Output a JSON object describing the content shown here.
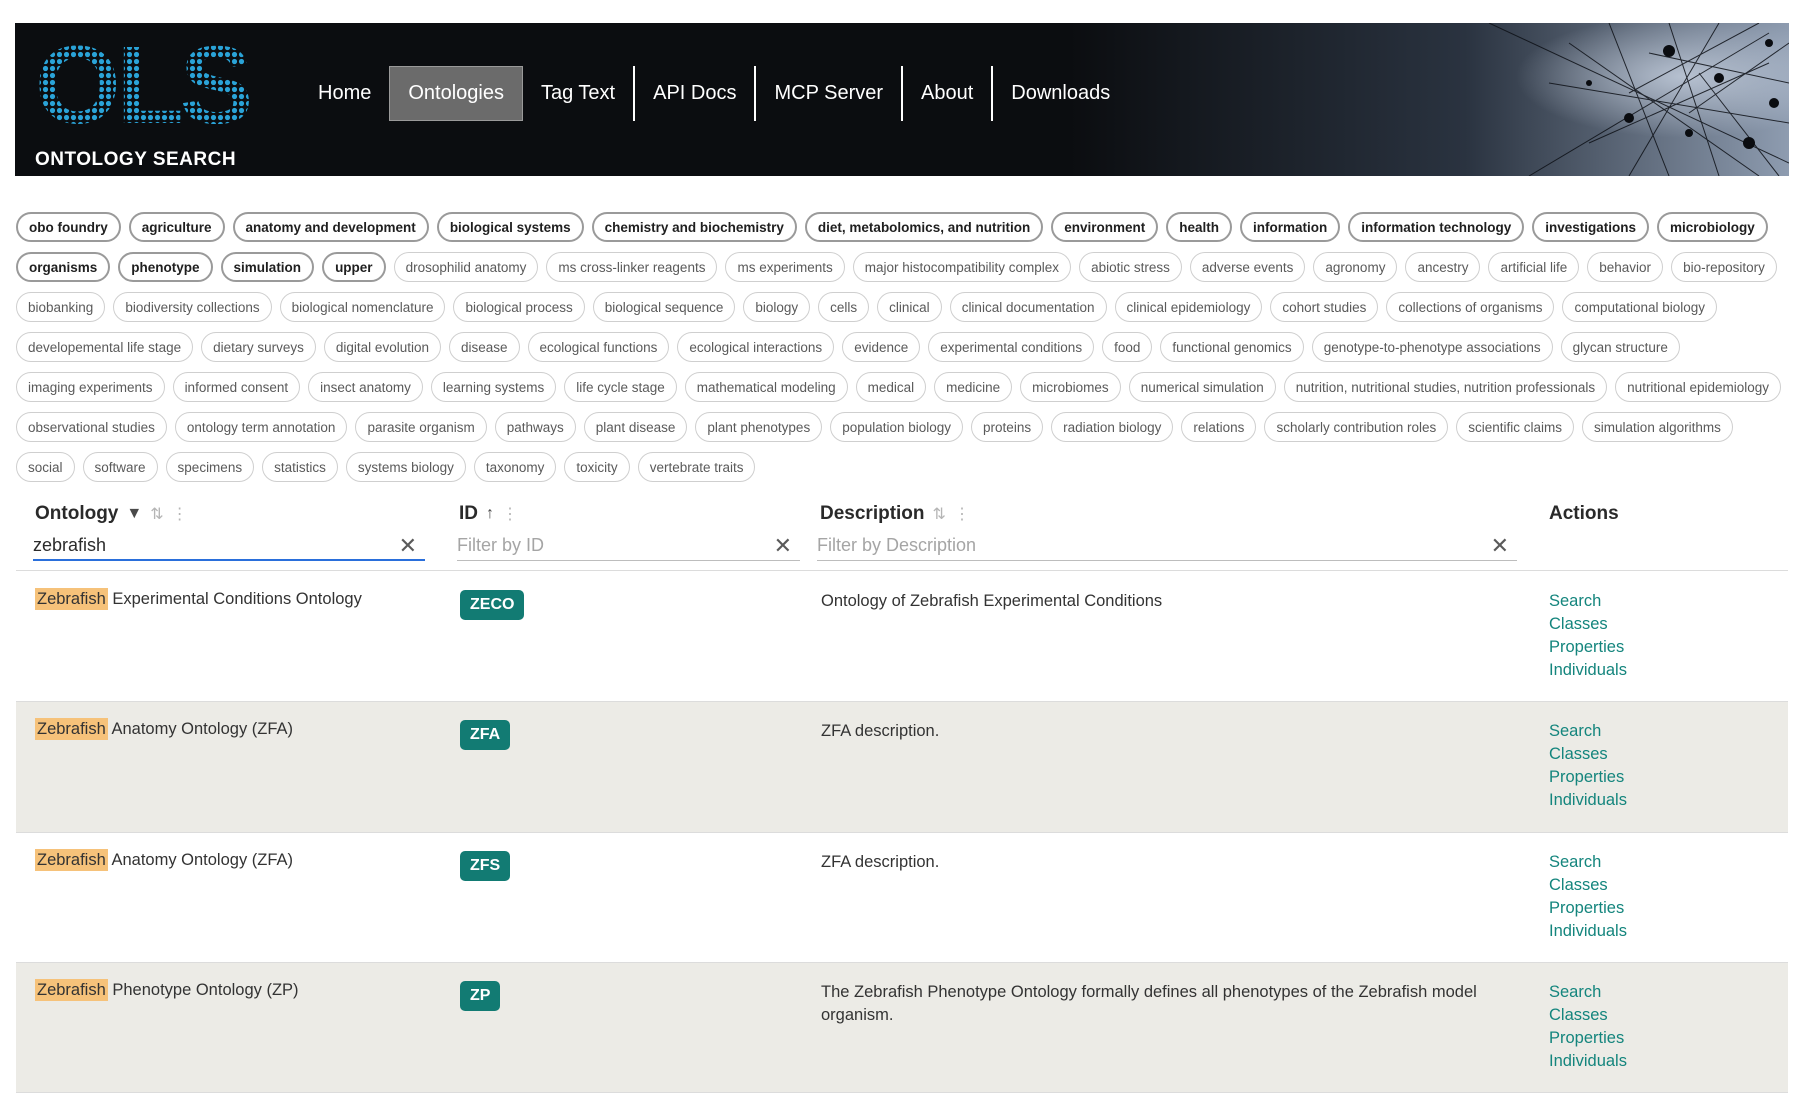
{
  "header": {
    "logo_text": "OLS",
    "logo_caption": "ONTOLOGY SEARCH",
    "nav": [
      "Home",
      "Ontologies",
      "Tag Text",
      "API Docs",
      "MCP Server",
      "About",
      "Downloads"
    ],
    "active_nav": "Ontologies"
  },
  "tags": {
    "bold": [
      "obo foundry",
      "agriculture",
      "anatomy and development",
      "biological systems",
      "chemistry and biochemistry",
      "diet, metabolomics, and nutrition",
      "environment",
      "health",
      "information",
      "information technology",
      "investigations",
      "microbiology",
      "organisms",
      "phenotype",
      "simulation",
      "upper"
    ],
    "normal": [
      "drosophilid anatomy",
      "ms cross-linker reagents",
      "ms experiments",
      "major histocompatibility complex",
      "abiotic stress",
      "adverse events",
      "agronomy",
      "ancestry",
      "artificial life",
      "behavior",
      "bio-repository",
      "biobanking",
      "biodiversity collections",
      "biological nomenclature",
      "biological process",
      "biological sequence",
      "biology",
      "cells",
      "clinical",
      "clinical documentation",
      "clinical epidemiology",
      "cohort studies",
      "collections of organisms",
      "computational biology",
      "developemental life stage",
      "dietary surveys",
      "digital evolution",
      "disease",
      "ecological functions",
      "ecological interactions",
      "evidence",
      "experimental conditions",
      "food",
      "functional genomics",
      "genotype-to-phenotype associations",
      "glycan structure",
      "imaging experiments",
      "informed consent",
      "insect anatomy",
      "learning systems",
      "life cycle stage",
      "mathematical modeling",
      "medical",
      "medicine",
      "microbiomes",
      "numerical simulation",
      "nutrition, nutritional studies, nutrition professionals",
      "nutritional epidemiology",
      "observational studies",
      "ontology term annotation",
      "parasite organism",
      "pathways",
      "plant disease",
      "plant phenotypes",
      "population biology",
      "proteins",
      "radiation biology",
      "relations",
      "scholarly contribution roles",
      "scientific claims",
      "simulation algorithms",
      "social",
      "software",
      "specimens",
      "statistics",
      "systems biology",
      "taxonomy",
      "toxicity",
      "vertebrate traits"
    ]
  },
  "table": {
    "columns": {
      "ontology": "Ontology",
      "id": "ID",
      "description": "Description",
      "actions": "Actions"
    },
    "filters": {
      "ontology_value": "zebrafish",
      "id_placeholder": "Filter by ID",
      "description_placeholder": "Filter by Description"
    },
    "rows": [
      {
        "highlight": "Zebrafish",
        "name_rest": " Experimental Conditions Ontology",
        "id": "ZECO",
        "description": "Ontology of Zebrafish Experimental Conditions"
      },
      {
        "highlight": "Zebrafish",
        "name_rest": " Anatomy Ontology (ZFA)",
        "id": "ZFA",
        "description": "ZFA description."
      },
      {
        "highlight": "Zebrafish",
        "name_rest": " Anatomy Ontology (ZFA)",
        "id": "ZFS",
        "description": "ZFA description."
      },
      {
        "highlight": "Zebrafish",
        "name_rest": " Phenotype Ontology (ZP)",
        "id": "ZP",
        "description": "The Zebrafish Phenotype Ontology formally defines all phenotypes of the Zebrafish model organism."
      }
    ],
    "action_labels": [
      "Search",
      "Classes",
      "Properties",
      "Individuals"
    ]
  },
  "colors": {
    "header_bg": "#0b0d10",
    "logo_blue": "#2aa3d8",
    "badge_teal": "#127b73",
    "link_teal": "#14857d",
    "highlight": "#f6c27a",
    "alt_row": "#ecebe6"
  }
}
